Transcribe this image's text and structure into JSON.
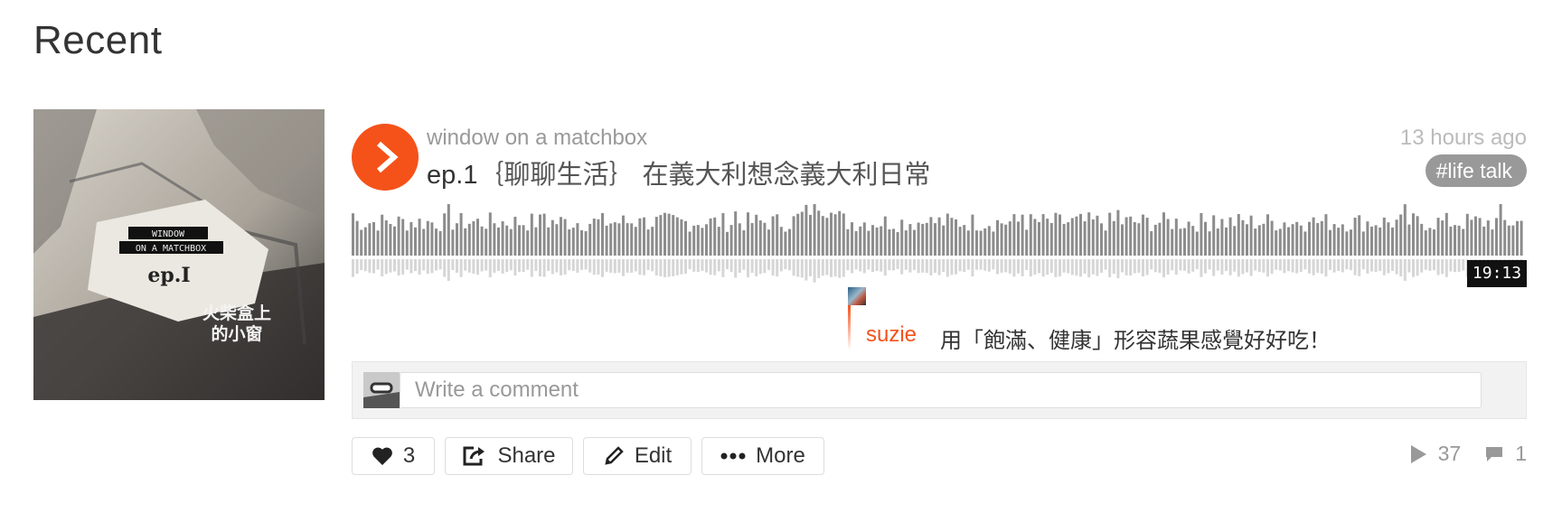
{
  "page": {
    "heading": "Recent"
  },
  "track": {
    "artwork": {
      "badge_line1": "WINDOW",
      "badge_line2": "ON A MATCHBOX",
      "episode": "ep.I",
      "cn_line1": "火柴盒上",
      "cn_line2": "的小窗"
    },
    "user": "window on a matchbox",
    "title_episode": "ep.1",
    "title_rest": "｛聊聊生活｝ 在義大利想念義大利日常",
    "posted": "13 hours ago",
    "tag": "life talk",
    "tag_hash": "#",
    "duration": "19:13",
    "play_icon": "play-icon",
    "accent_color": "#f5521a"
  },
  "comment": {
    "user": "suzie",
    "text": "用「飽滿、健康」形容蔬果感覺好好吃！"
  },
  "comment_form": {
    "placeholder": "Write a comment"
  },
  "actions": {
    "like_count": "3",
    "share_label": "Share",
    "edit_label": "Edit",
    "more_label": "More"
  },
  "stats": {
    "plays": "37",
    "comments": "1"
  }
}
